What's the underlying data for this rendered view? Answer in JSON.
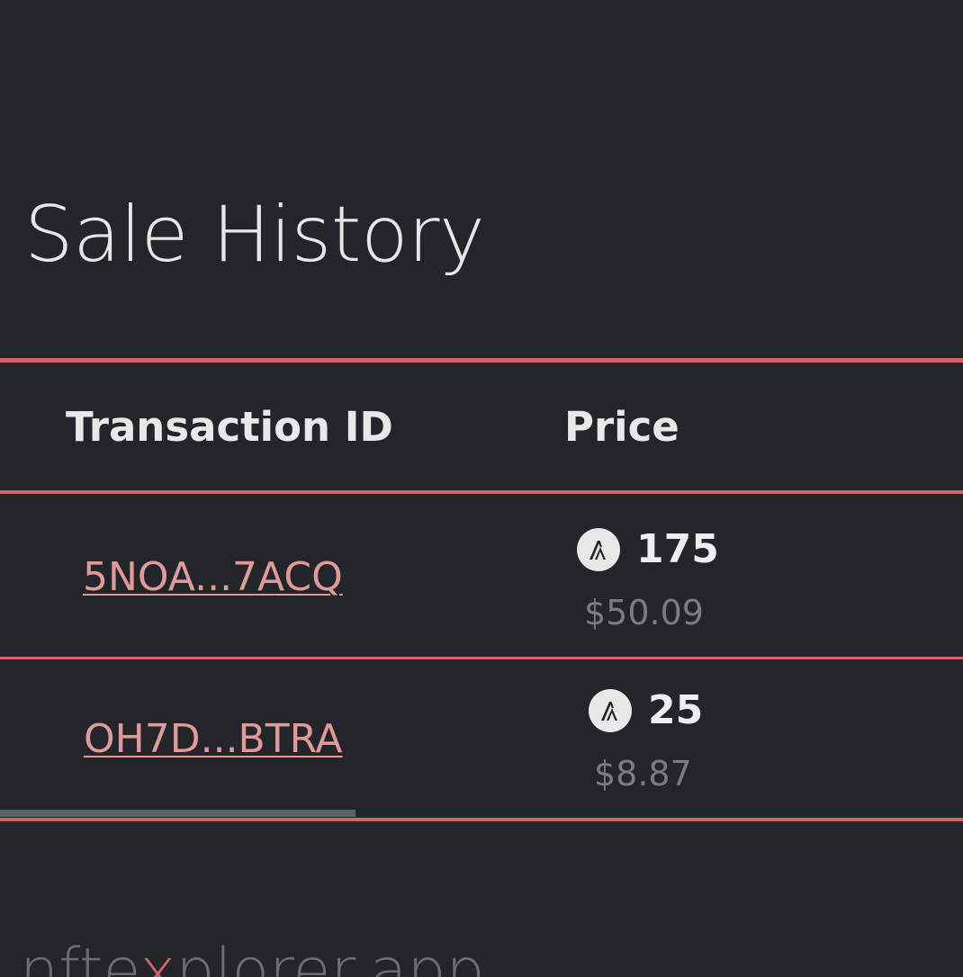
{
  "section": {
    "title": "Sale History"
  },
  "table": {
    "columns": [
      "Transaction ID",
      "Price"
    ],
    "rows": [
      {
        "transaction_id": "5NOA...7ACQ",
        "price_algo": "175",
        "price_usd": "$50.09"
      },
      {
        "transaction_id": "OH7D...BTRA",
        "price_algo": "25",
        "price_usd": "$8.87"
      }
    ],
    "currency_icon": "algorand-icon"
  },
  "footer": {
    "brand_prefix": "nfte",
    "brand_accent": "x",
    "brand_suffix": "plorer.app"
  },
  "colors": {
    "background": "#222529",
    "accent": "#d06464",
    "link": "#e19a9a",
    "muted": "#7a7c80"
  }
}
